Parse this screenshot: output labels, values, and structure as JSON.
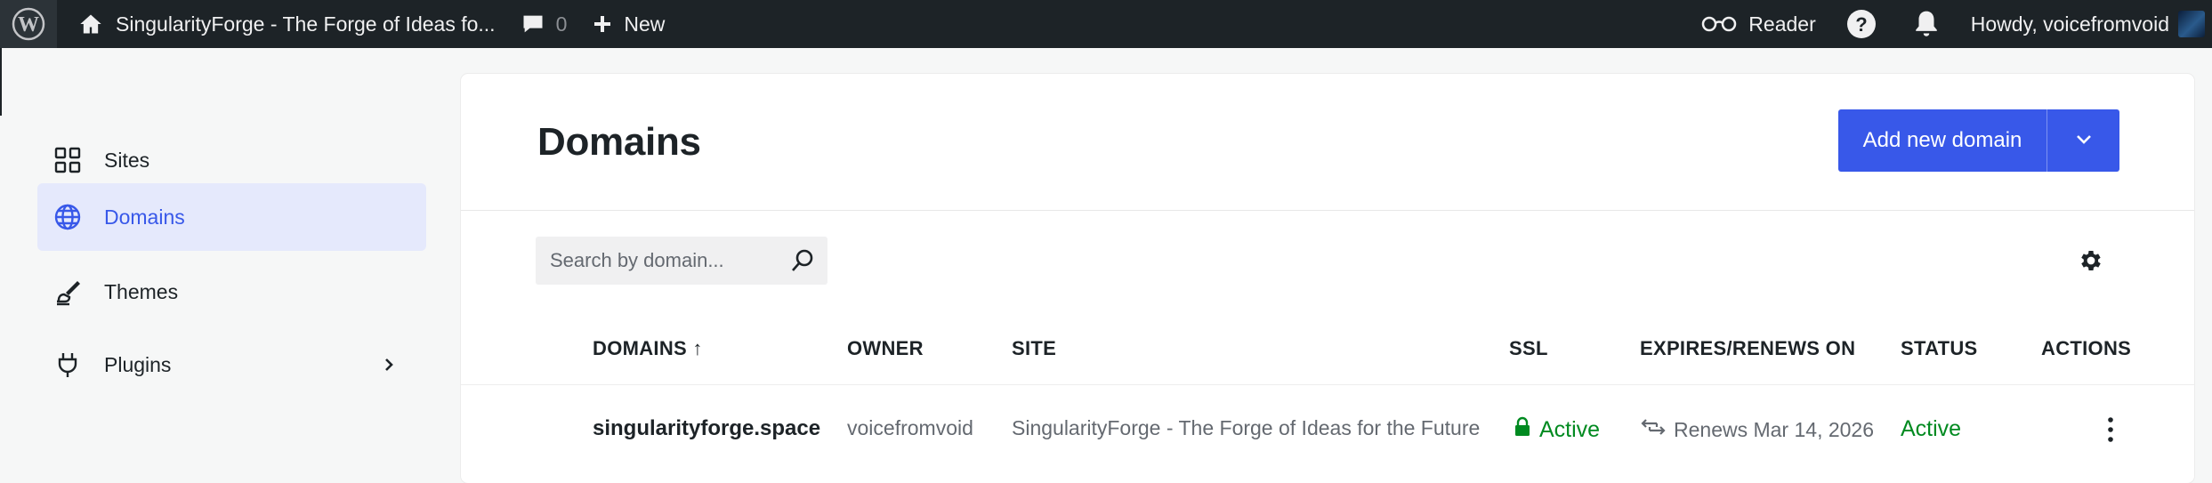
{
  "adminbar": {
    "site_title": "SingularityForge - The Forge of Ideas fo...",
    "comments_count": "0",
    "new_label": "New",
    "reader_label": "Reader",
    "howdy": "Howdy, voicefromvoid"
  },
  "sidebar": {
    "items": [
      {
        "label": "Sites",
        "icon": "grid-icon"
      },
      {
        "label": "Domains",
        "icon": "globe-icon",
        "active": true
      },
      {
        "label": "Themes",
        "icon": "brush-icon"
      },
      {
        "label": "Plugins",
        "icon": "plug-icon",
        "has_submenu": true
      }
    ]
  },
  "main": {
    "title": "Domains",
    "add_button": "Add new domain",
    "search": {
      "placeholder": "Search by domain..."
    },
    "table": {
      "headers": {
        "domains": "DOMAINS ↑",
        "owner": "OWNER",
        "site": "SITE",
        "ssl": "SSL",
        "expires": "EXPIRES/RENEWS ON",
        "status": "STATUS",
        "actions": "ACTIONS"
      },
      "rows": [
        {
          "domain": "singularityforge.space",
          "owner": "voicefromvoid",
          "site": "SingularityForge - The Forge of Ideas for the Future",
          "ssl": "Active",
          "renews": "Renews Mar 14, 2026",
          "status": "Active"
        }
      ]
    }
  },
  "colors": {
    "adminbar_bg": "#1d2327",
    "accent": "#3858e9",
    "active_nav_bg": "#e5e9fc",
    "success": "#008a20"
  }
}
